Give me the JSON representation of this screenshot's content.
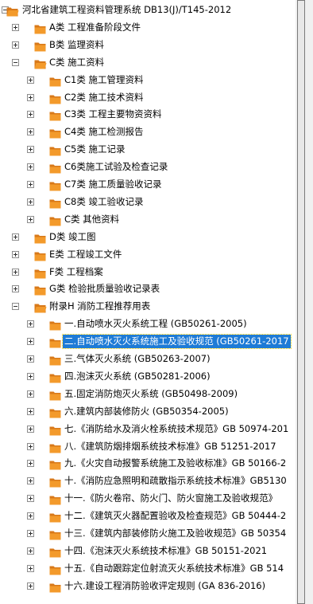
{
  "tree": {
    "root_label": "河北省建筑工程资料管理系统 DB13(J)/T145-2012",
    "categories": [
      {
        "label": "A类 工程准备阶段文件"
      },
      {
        "label": "B类 监理资料"
      },
      {
        "label": "C类 施工资料"
      },
      {
        "label": "D类 竣工图"
      },
      {
        "label": "E类 工程竣工文件"
      },
      {
        "label": "F类 工程档案"
      },
      {
        "label": "G类 检验批质量验收记录表"
      },
      {
        "label": "附录H 消防工程推荐用表"
      }
    ],
    "c_children": [
      {
        "label": "C1类 施工管理资料"
      },
      {
        "label": "C2类 施工技术资料"
      },
      {
        "label": "C3类 工程主要物资资料"
      },
      {
        "label": "C4类 施工检测报告"
      },
      {
        "label": "C5类 施工记录"
      },
      {
        "label": "C6类施工试验及检查记录"
      },
      {
        "label": "C7类 施工质量验收记录"
      },
      {
        "label": "C8类 竣工验收记录"
      },
      {
        "label": "C类 其他资料"
      }
    ],
    "h_children": [
      {
        "label": "一.自动喷水灭火系统工程 (GB50261-2005)"
      },
      {
        "label": "二.自动喷水灭火系统施工及验收规范 (GB50261-2017"
      },
      {
        "label": "三.气体灭火系统 (GB50263-2007)"
      },
      {
        "label": "四.泡沫灭火系统 (GB50281-2006)"
      },
      {
        "label": "五.固定消防炮灭火系统 (GB50498-2009)"
      },
      {
        "label": "六.建筑内部装修防火 (GB50354-2005)"
      },
      {
        "label": "七.《消防给水及消火栓系统技术规范》GB 50974-201"
      },
      {
        "label": "八.《建筑防烟排烟系统技术标准》GB 51251-2017"
      },
      {
        "label": "九.《火灾自动报警系统施工及验收标准》GB 50166-2"
      },
      {
        "label": "十.《消防应急照明和疏散指示系统技术标准》GB5130"
      },
      {
        "label": "十一.《防火卷帘、防火门、防火窗施工及验收规范》"
      },
      {
        "label": "十二.《建筑灭火器配置验收及检查规范》GB 50444-2"
      },
      {
        "label": "十三.《建筑内部装修防火施工及验收规范》GB 50354"
      },
      {
        "label": "十四.《泡沫灭火系统技术标准》GB 50151-2021"
      },
      {
        "label": "十五.《自动跟踪定位射流灭火系统技术标准》GB 514"
      },
      {
        "label": "十六.建设工程消防验收评定规则 (GA 836-2016)"
      }
    ],
    "selected_item": "二.自动喷水灭火系统施工及验收规范 (GB50261-2017"
  },
  "colors": {
    "selection": "#1e7bd6",
    "folder": "#f39a2b",
    "folder_dark": "#d8791a"
  }
}
